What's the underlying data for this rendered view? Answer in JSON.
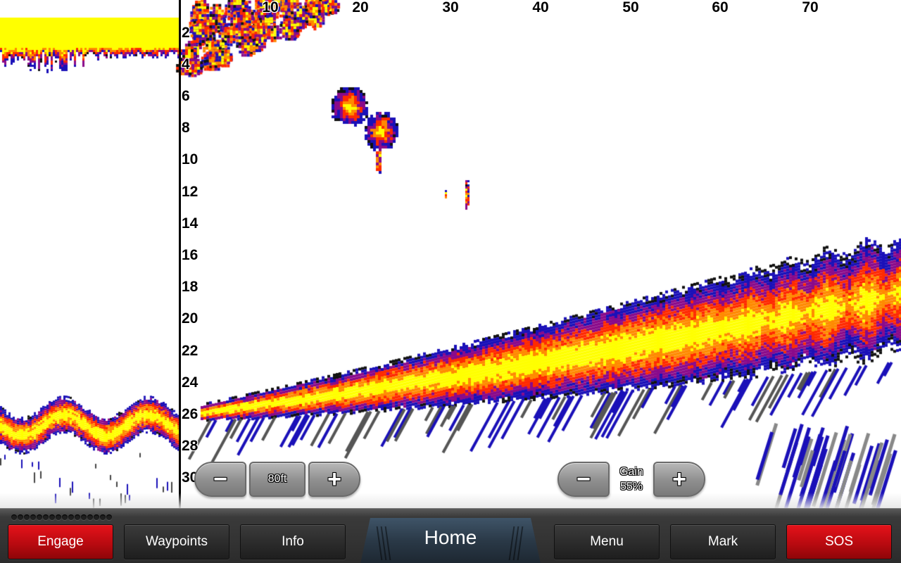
{
  "sonar": {
    "depth_scale": {
      "unit": "ft",
      "labels": [
        "2",
        "4",
        "6",
        "8",
        "10",
        "12",
        "14",
        "16",
        "18",
        "20",
        "22",
        "24",
        "26",
        "28",
        "30"
      ]
    },
    "distance_scale": {
      "labels": [
        "10",
        "20",
        "30",
        "40",
        "50",
        "60",
        "70"
      ]
    },
    "palette": {
      "strong": "#ffff00",
      "medium": "#ff8a00",
      "mid": "#ff2a00",
      "weak": "#8a0a8a",
      "faint": "#1a10b8",
      "shadow": "#111111"
    }
  },
  "range_control": {
    "decrease_label": "−",
    "value": "80ft",
    "increase_label": "+"
  },
  "gain_control": {
    "decrease_label": "−",
    "title": "Gain",
    "value": "55%",
    "increase_label": "+"
  },
  "bottom_bar": {
    "buttons": [
      {
        "label": "Engage",
        "style": "red"
      },
      {
        "label": "Waypoints",
        "style": "dark"
      },
      {
        "label": "Info",
        "style": "dark"
      },
      {
        "label": "Home",
        "style": "tab"
      },
      {
        "label": "Menu",
        "style": "dark"
      },
      {
        "label": "Mark",
        "style": "dark"
      },
      {
        "label": "SOS",
        "style": "red"
      }
    ],
    "colors": {
      "red": "#d10d14",
      "dark": "#262626",
      "home": "#2c3a48"
    }
  }
}
